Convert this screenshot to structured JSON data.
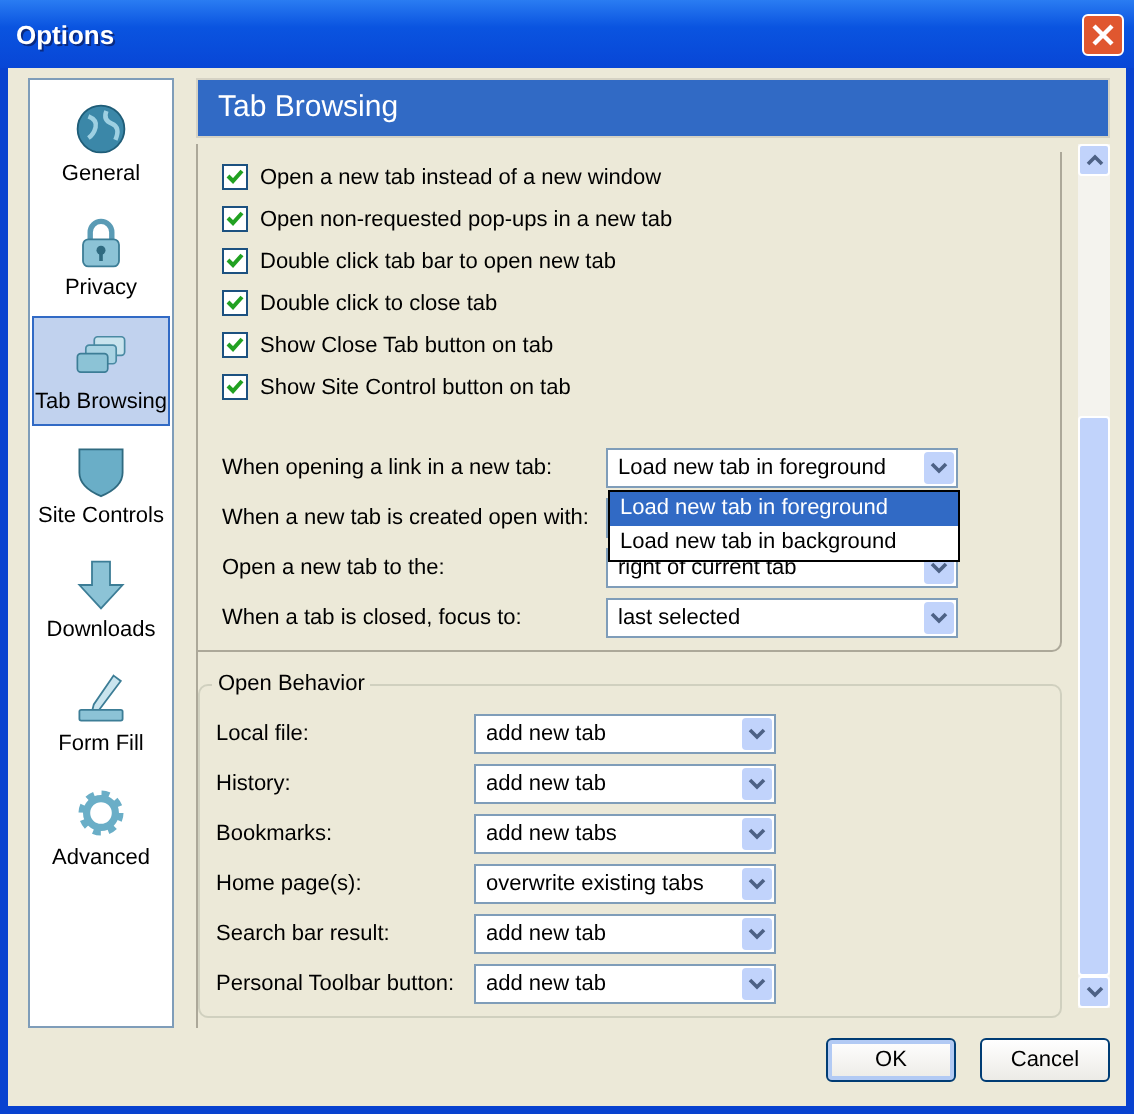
{
  "window": {
    "title": "Options"
  },
  "sidebar": {
    "items": [
      {
        "label": "General",
        "kind": "globe",
        "selected": false
      },
      {
        "label": "Privacy",
        "kind": "lock",
        "selected": false
      },
      {
        "label": "Tab Browsing",
        "kind": "tabs",
        "selected": true
      },
      {
        "label": "Site Controls",
        "kind": "shield",
        "selected": false
      },
      {
        "label": "Downloads",
        "kind": "download",
        "selected": false
      },
      {
        "label": "Form Fill",
        "kind": "pen",
        "selected": false
      },
      {
        "label": "Advanced",
        "kind": "gear",
        "selected": false
      }
    ]
  },
  "header": "Tab Browsing",
  "checkboxes": [
    {
      "label": "Open a new tab instead of a new window",
      "checked": true
    },
    {
      "label": "Open non-requested pop-ups in a new tab",
      "checked": true
    },
    {
      "label": "Double click tab bar to open new tab",
      "checked": true
    },
    {
      "label": "Double click to close tab",
      "checked": true
    },
    {
      "label": "Show Close Tab button on tab",
      "checked": true
    },
    {
      "label": "Show Site Control button on tab",
      "checked": true
    }
  ],
  "tab_settings": [
    {
      "label": "When opening a link in a new tab:",
      "value": "Load new tab in foreground",
      "options": [
        {
          "label": "Load new tab in foreground",
          "selected": true
        },
        {
          "label": "Load new tab in background",
          "selected": false
        }
      ]
    },
    {
      "label": "When a new tab is created open with:"
    },
    {
      "label": "Open a new tab to the:",
      "value": "right of current tab"
    },
    {
      "label": "When a tab is closed, focus to:",
      "value": "last selected"
    }
  ],
  "open_behavior": {
    "title": "Open Behavior",
    "rows": [
      {
        "label": "Local file:",
        "value": "add new tab"
      },
      {
        "label": "History:",
        "value": "add new tab"
      },
      {
        "label": "Bookmarks:",
        "value": "add new tabs"
      },
      {
        "label": "Home page(s):",
        "value": "overwrite existing tabs"
      },
      {
        "label": "Search bar result:",
        "value": "add new tab"
      },
      {
        "label": "Personal Toolbar button:",
        "value": "add new tab"
      }
    ]
  },
  "buttons": [
    {
      "label": "OK",
      "default": true
    },
    {
      "label": "Cancel",
      "default": false
    }
  ]
}
